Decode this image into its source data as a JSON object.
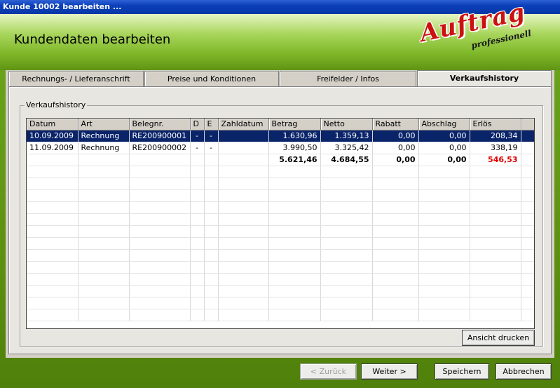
{
  "window": {
    "title": "Kunde 10002 bearbeiten ..."
  },
  "header": {
    "title": "Kundendaten bearbeiten",
    "logo_main": "Auftrag",
    "logo_sub": "professionell"
  },
  "tabs": [
    {
      "label": "Rechnungs- /  Lieferanschrift"
    },
    {
      "label": "Preise und Konditionen"
    },
    {
      "label": "Freifelder / Infos"
    },
    {
      "label": "Verkaufshistory"
    }
  ],
  "group": {
    "label": "Verkaufshistory"
  },
  "table": {
    "columns": [
      "Datum",
      "Art",
      "Belegnr.",
      "D",
      "E",
      "Zahldatum",
      "Betrag",
      "Netto",
      "Rabatt",
      "Abschlag",
      "Erlös"
    ],
    "rows": [
      [
        "10.09.2009",
        "Rechnung",
        "RE200900001",
        "-",
        "-",
        "",
        "1.630,96",
        "1.359,13",
        "0,00",
        "0,00",
        "208,34"
      ],
      [
        "11.09.2009",
        "Rechnung",
        "RE200900002",
        "-",
        "-",
        "",
        "3.990,50",
        "3.325,42",
        "0,00",
        "0,00",
        "338,19"
      ]
    ],
    "totals": [
      "",
      "",
      "",
      "",
      "",
      "",
      "5.621,46",
      "4.684,55",
      "0,00",
      "0,00",
      "546,53"
    ]
  },
  "buttons": {
    "print": "Ansicht drucken",
    "back": "< Zurück",
    "next": "Weiter >",
    "save": "Speichern",
    "cancel": "Abbrechen"
  },
  "colors": {
    "selection": "#0a246a",
    "accent_green": "#7fb82a",
    "total_red": "#e00000"
  }
}
